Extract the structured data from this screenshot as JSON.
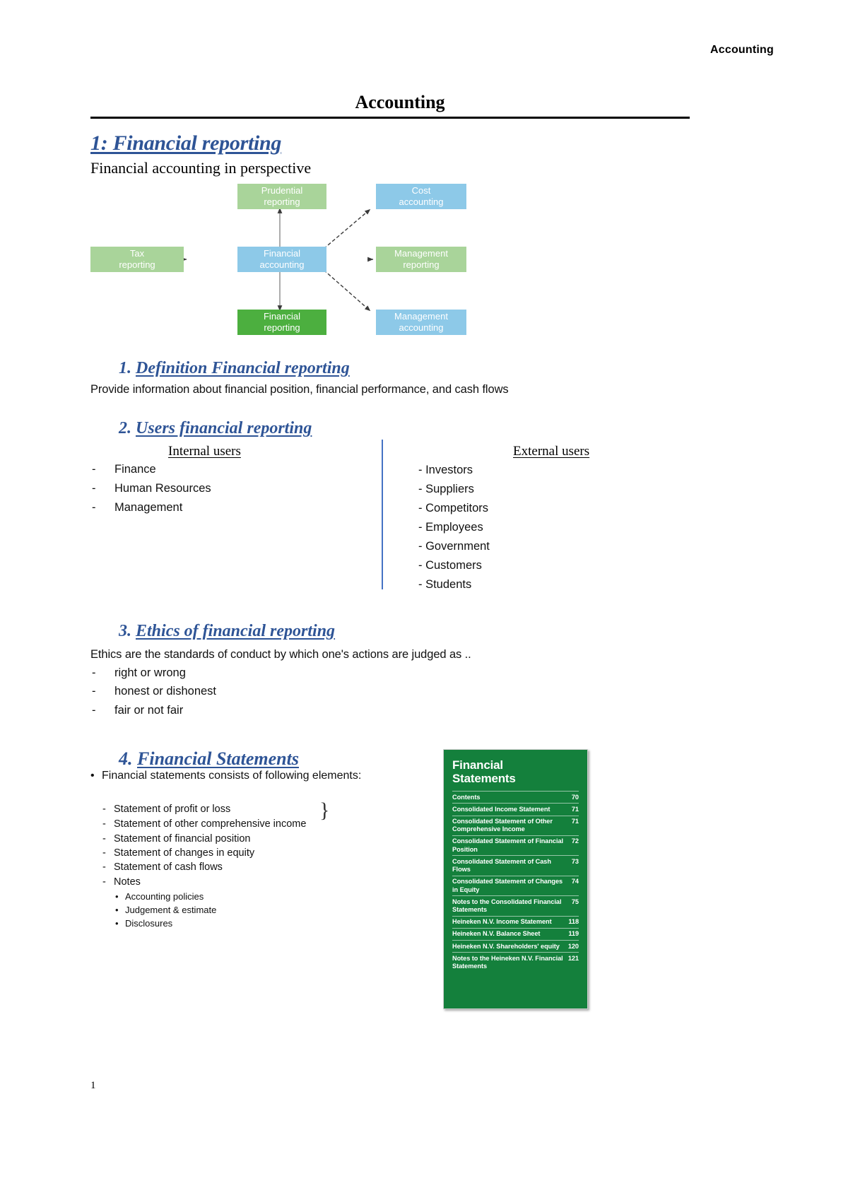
{
  "header": {
    "running_head": "Accounting",
    "doc_title": "Accounting"
  },
  "chapter": {
    "title": "1: Financial reporting",
    "subtitle": "Financial accounting in perspective"
  },
  "diagram": {
    "colors": {
      "light_green": "#A9D49A",
      "light_blue": "#8DC9E8",
      "dark_green": "#4CAF3F",
      "arrow": "#595959"
    },
    "boxes": [
      {
        "id": "prudential-reporting",
        "label_line1": "Prudential",
        "label_line2": "reporting",
        "color": "#A9D49A"
      },
      {
        "id": "cost-accounting",
        "label_line1": "Cost",
        "label_line2": "accounting",
        "color": "#8DC9E8"
      },
      {
        "id": "tax-reporting",
        "label_line1": "Tax",
        "label_line2": "reporting",
        "color": "#A9D49A"
      },
      {
        "id": "financial-accounting",
        "label_line1": "Financial",
        "label_line2": "accounting",
        "color": "#8DC9E8"
      },
      {
        "id": "management-reporting",
        "label_line1": "Management",
        "label_line2": "reporting",
        "color": "#A9D49A"
      },
      {
        "id": "financial-reporting",
        "label_line1": "Financial",
        "label_line2": "reporting",
        "color": "#4CAF3F"
      },
      {
        "id": "management-accounting",
        "label_line1": "Management",
        "label_line2": "accounting",
        "color": "#8DC9E8"
      }
    ]
  },
  "sections": {
    "s1": {
      "number": "1.",
      "title": "Definition Financial reporting",
      "body": "Provide information about financial position, financial performance, and cash flows"
    },
    "s2": {
      "number": "2.",
      "title": "Users financial reporting",
      "internal_heading": "Internal users",
      "external_heading": "External users",
      "internal_users": [
        "Finance",
        "Human Resources",
        "Management"
      ],
      "external_users": [
        "Investors",
        "Suppliers",
        "Competitors",
        "Employees",
        "Government",
        "Customers",
        "Students"
      ]
    },
    "s3": {
      "number": "3.",
      "title": "Ethics of financial reporting",
      "body": "Ethics are the standards of conduct by which one's actions are judged as ..",
      "items": [
        "right or wrong",
        "honest or dishonest",
        "fair or not fair"
      ]
    },
    "s4": {
      "number": "4.",
      "title": "Financial Statements",
      "intro": "Financial statements consists of following elements:",
      "elements": [
        "Statement of profit or loss",
        "Statement of other comprehensive income",
        "Statement of financial position",
        "Statement of changes in equity",
        "Statement of cash flows",
        "Notes"
      ],
      "note_subitems": [
        "Accounting policies",
        "Judgement & estimate",
        "Disclosures"
      ]
    }
  },
  "toc_panel": {
    "title_line1": "Financial",
    "title_line2": "Statements",
    "accent_color": "#14803C",
    "rows": [
      {
        "label": "Contents",
        "page": "70"
      },
      {
        "label": "Consolidated Income Statement",
        "page": "71"
      },
      {
        "label": "Consolidated Statement of Other Comprehensive Income",
        "page": "71"
      },
      {
        "label": "Consolidated Statement of Financial Position",
        "page": "72"
      },
      {
        "label": "Consolidated Statement of Cash Flows",
        "page": "73"
      },
      {
        "label": "Consolidated Statement of Changes in Equity",
        "page": "74"
      },
      {
        "label": "Notes to the Consolidated Financial Statements",
        "page": "75"
      },
      {
        "label": "Heineken N.V. Income Statement",
        "page": "118"
      },
      {
        "label": "Heineken N.V. Balance Sheet",
        "page": "119"
      },
      {
        "label": "Heineken N.V. Shareholders' equity",
        "page": "120"
      },
      {
        "label": "Notes to the Heineken N.V. Financial Statements",
        "page": "121"
      }
    ]
  },
  "footer": {
    "page_number": "1"
  }
}
